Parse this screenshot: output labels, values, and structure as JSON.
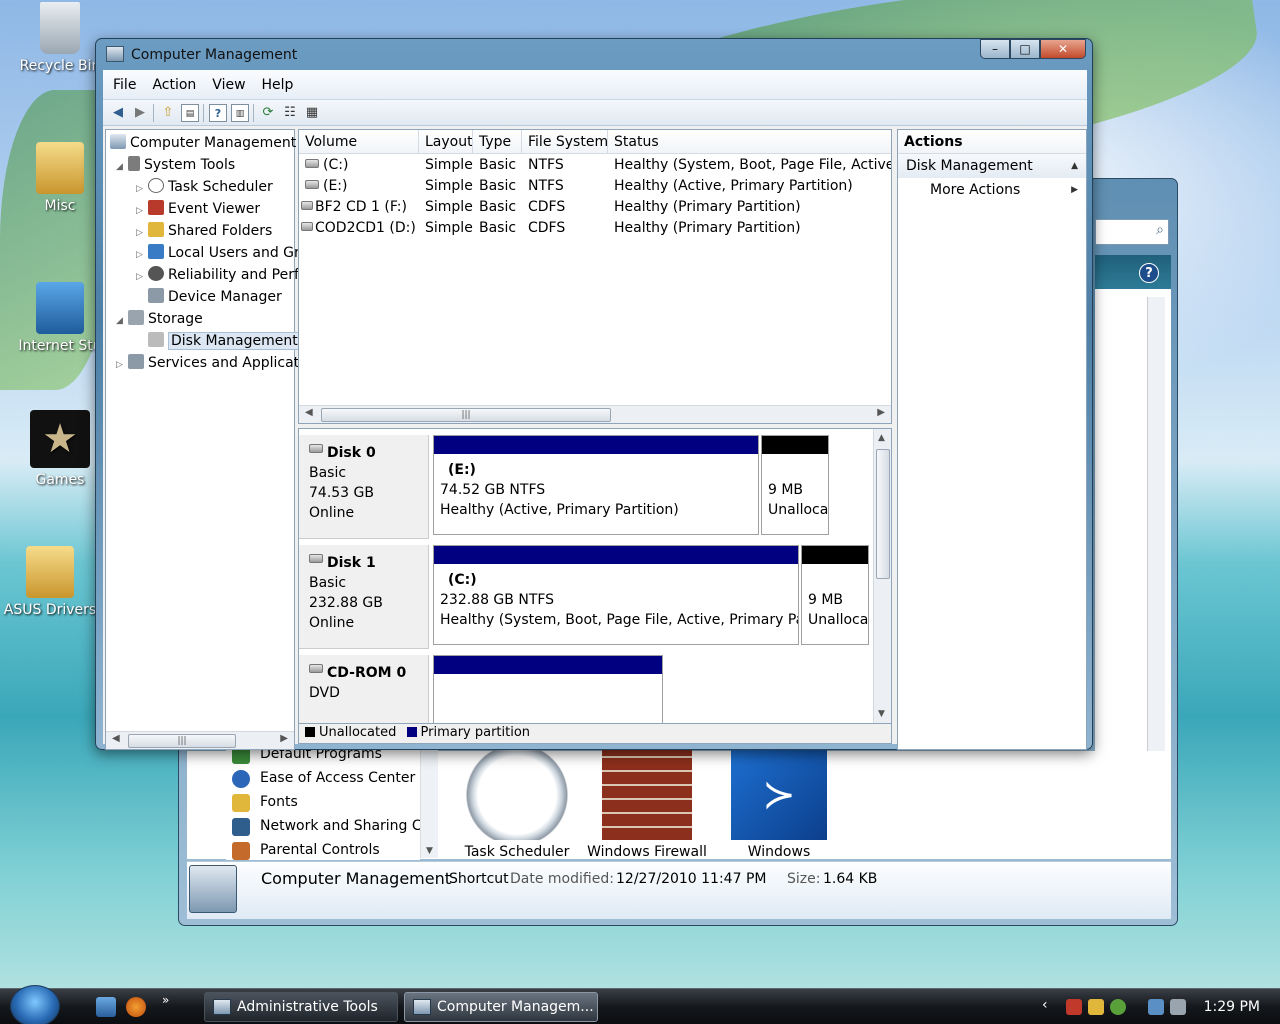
{
  "desktop": {
    "icons": [
      "Recycle Bin",
      "Misc",
      "Internet Stu",
      "Games",
      "ASUS Drivers"
    ]
  },
  "back_window": {
    "cp_items": [
      "Default Programs",
      "Ease of Access Center",
      "Fonts",
      "Network and Sharing Ce",
      "Parental Controls"
    ],
    "big_icons": [
      "Task Scheduler",
      "Windows Firewall",
      "Windows"
    ],
    "details": {
      "name": "Computer Management",
      "type": "Shortcut",
      "date_label": "Date modified:",
      "date_value": "12/27/2010 11:47 PM",
      "size_label": "Size:",
      "size_value": "1.64 KB"
    }
  },
  "window": {
    "title": "Computer Management",
    "buttons": {
      "minimize": "–",
      "maximize": "□",
      "close": "✕"
    }
  },
  "menu": [
    "File",
    "Action",
    "View",
    "Help"
  ],
  "tree": {
    "root": "Computer Management",
    "system_tools": "System Tools",
    "task_scheduler": "Task Scheduler",
    "event_viewer": "Event Viewer",
    "shared_folders": "Shared Folders",
    "local_users": "Local Users and Gr",
    "reliability": "Reliability and Perf",
    "device_manager": "Device Manager",
    "storage": "Storage",
    "disk_management": "Disk Management",
    "services": "Services and Applicat"
  },
  "volume_table": {
    "headers": [
      "Volume",
      "Layout",
      "Type",
      "File System",
      "Status"
    ],
    "rows": [
      [
        "(C:)",
        "Simple",
        "Basic",
        "NTFS",
        "Healthy (System, Boot, Page File, Active, P"
      ],
      [
        "(E:)",
        "Simple",
        "Basic",
        "NTFS",
        "Healthy (Active, Primary Partition)"
      ],
      [
        "BF2 CD 1 (F:)",
        "Simple",
        "Basic",
        "CDFS",
        "Healthy (Primary Partition)"
      ],
      [
        "COD2CD1 (D:)",
        "Simple",
        "Basic",
        "CDFS",
        "Healthy (Primary Partition)"
      ]
    ]
  },
  "disks": [
    {
      "name": "Disk 0",
      "type": "Basic",
      "size": "74.53 GB",
      "status": "Online",
      "primary": {
        "label": "(E:)",
        "size": "74.52 GB NTFS",
        "status": "Healthy (Active, Primary Partition)"
      },
      "unalloc": {
        "size": "9 MB",
        "label": "Unalloca"
      }
    },
    {
      "name": "Disk 1",
      "type": "Basic",
      "size": "232.88 GB",
      "status": "Online",
      "primary": {
        "label": "(C:)",
        "size": "232.88 GB NTFS",
        "status": "Healthy (System, Boot, Page File, Active, Primary Parti"
      },
      "unalloc": {
        "size": "9 MB",
        "label": "Unalloca"
      }
    },
    {
      "name": "CD-ROM 0",
      "type": "DVD"
    }
  ],
  "legend": {
    "unallocated": "Unallocated",
    "primary": "Primary partition"
  },
  "colors": {
    "primary_partition": "#000080",
    "unallocated": "#000000"
  },
  "actions": {
    "header": "Actions",
    "section": "Disk Management",
    "more": "More Actions"
  },
  "taskbar": {
    "tasks": [
      "Administrative Tools",
      "Computer Managem..."
    ],
    "clock": "1:29 PM"
  }
}
